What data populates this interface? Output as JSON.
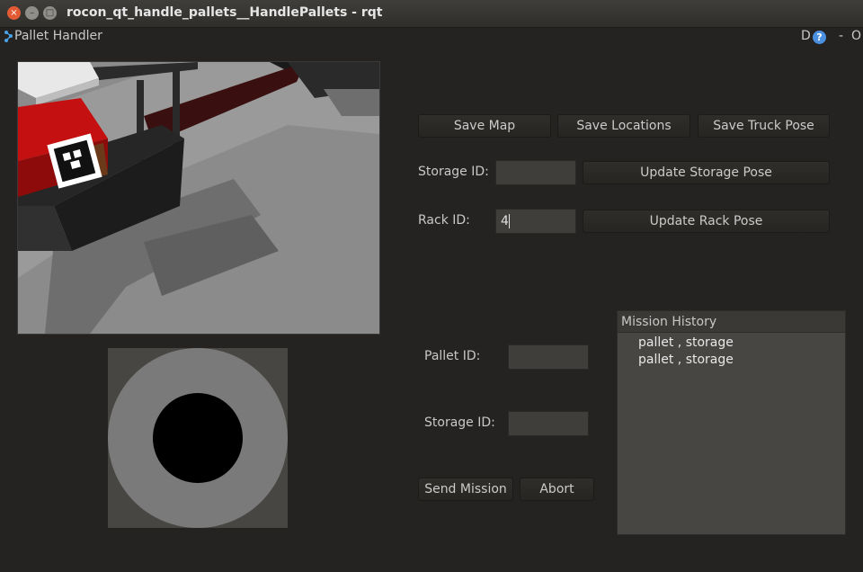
{
  "window": {
    "title": "rocon_qt_handle_pallets__HandlePallets - rqt",
    "close_glyph": "×",
    "min_glyph": "–",
    "max_glyph": "□"
  },
  "plugin": {
    "title": "Pallet Handler",
    "d_label": "D",
    "help_glyph": "?",
    "dash_label": "-",
    "o_label": "O",
    "icon": "rqt-plugin-icon"
  },
  "toolbar": {
    "save_map": "Save Map",
    "save_locations": "Save Locations",
    "save_truck_pose": "Save Truck Pose"
  },
  "storage": {
    "label": "Storage ID:",
    "value": "",
    "update_button": "Update Storage Pose"
  },
  "rack": {
    "label": "Rack ID:",
    "value": "4",
    "update_button": "Update Rack Pose"
  },
  "mission": {
    "pallet_label": "Pallet ID:",
    "pallet_value": "",
    "storage_label": "Storage ID:",
    "storage_value": "",
    "send_button": "Send Mission",
    "abort_button": "Abort"
  },
  "history": {
    "header": "Mission History",
    "items": [
      "pallet , storage",
      "pallet , storage"
    ]
  },
  "colors": {
    "background": "#242321",
    "button": "#2b2a27",
    "field": "#3f3e3b",
    "pallet_box": "#c41010",
    "help_icon": "#4a8fe0"
  }
}
